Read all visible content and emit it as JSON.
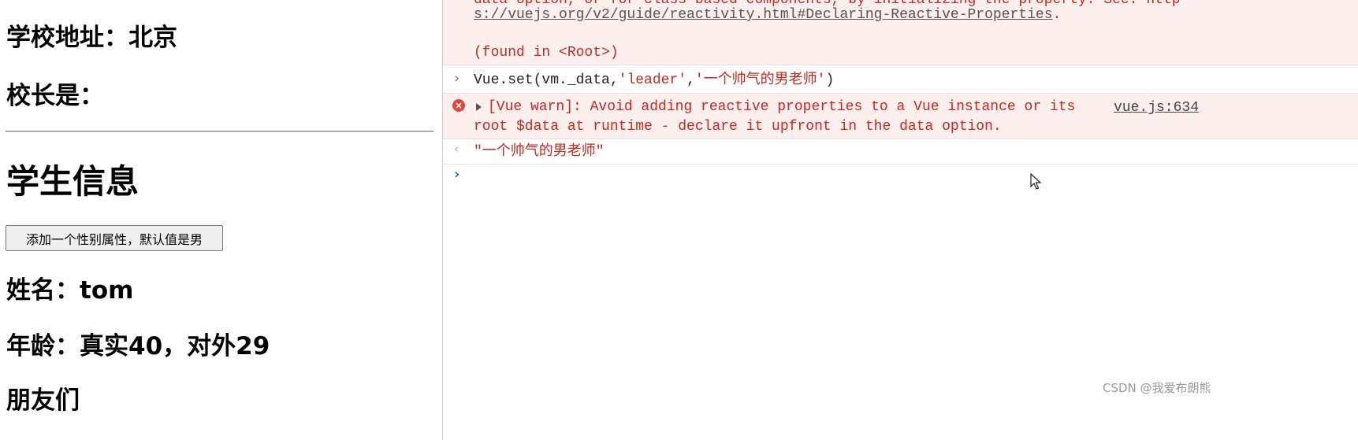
{
  "page": {
    "school_address": "学校地址：北京",
    "principal": "校长是：",
    "student_heading": "学生信息",
    "add_sex_button": "添加一个性别属性，默认值是男",
    "name": "姓名：tom",
    "age": "年龄：真实40，对外29",
    "friends_partial": "朋友们"
  },
  "console": {
    "prev_warning": {
      "line1_partial": "data option, or for class-based components, by initializing the property. See: http",
      "link": "s://vuejs.org/v2/guide/reactivity.html#Declaring-Reactive-Properties",
      "link_suffix": ".",
      "found_in": "(found in <Root>)"
    },
    "input": {
      "prefix": "Vue.set(vm._data,",
      "arg1": "'leader'",
      "comma": ",",
      "arg2": "'一个帅气的男老师'",
      "suffix": ")"
    },
    "warning": {
      "line1": "[Vue warn]: Avoid adding reactive properties to a Vue instance or its",
      "line2": "root $data at runtime - declare it upfront in the data option.",
      "source": "vue.js:634"
    },
    "result": "\"一个帅气的男老师\"",
    "colors": {
      "warn_bg": "#fcefee",
      "warn_text": "#c8281e",
      "prompt": "#1a73e8"
    }
  },
  "watermark": "CSDN @我爱布朗熊"
}
